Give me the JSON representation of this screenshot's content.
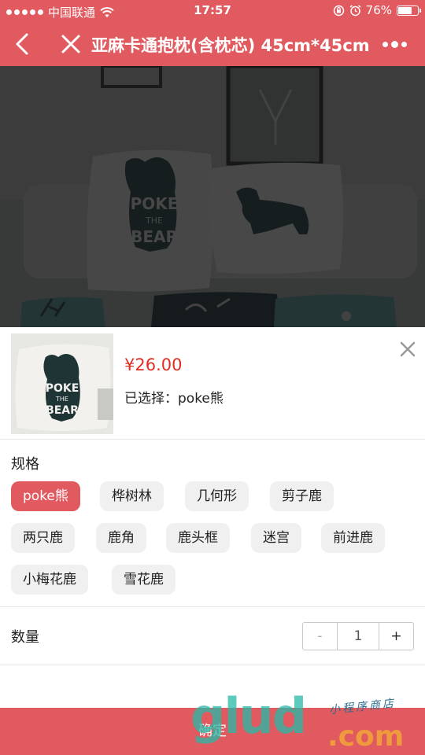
{
  "status_bar": {
    "carrier": "中国联通",
    "time": "17:57",
    "battery": "76%",
    "battery_level": 0.76
  },
  "nav": {
    "title": "亚麻卡通抱枕(含枕芯) 45cm*45cm"
  },
  "hero": {
    "pillow_left_text": [
      "POKE",
      "THE",
      "BEAR"
    ]
  },
  "product": {
    "price": "¥26.00",
    "selected_label": "已选择：",
    "selected_value": "poke熊",
    "thumb_text": [
      "POKE",
      "THE",
      "BEAR"
    ]
  },
  "spec": {
    "title": "规格",
    "options": [
      "poke熊",
      "桦树林",
      "几何形",
      "剪子鹿",
      "两只鹿",
      "鹿角",
      "鹿头框",
      "迷宫",
      "前进鹿",
      "小梅花鹿",
      "雪花鹿"
    ],
    "selected": "poke熊"
  },
  "quantity": {
    "label": "数量",
    "minus": "-",
    "value": "1",
    "plus": "+"
  },
  "confirm_label": "确定",
  "watermark": {
    "main": "glud",
    "dot_com": ".com",
    "sub": "小程序商店"
  },
  "colors": {
    "brand": "#e05a5f",
    "price": "#e02e24",
    "chip_bg": "#f0f0f0"
  },
  "icons": {
    "back": "chevron-left-icon",
    "close": "close-icon",
    "more": "more-icon",
    "sheet_close": "close-icon"
  }
}
